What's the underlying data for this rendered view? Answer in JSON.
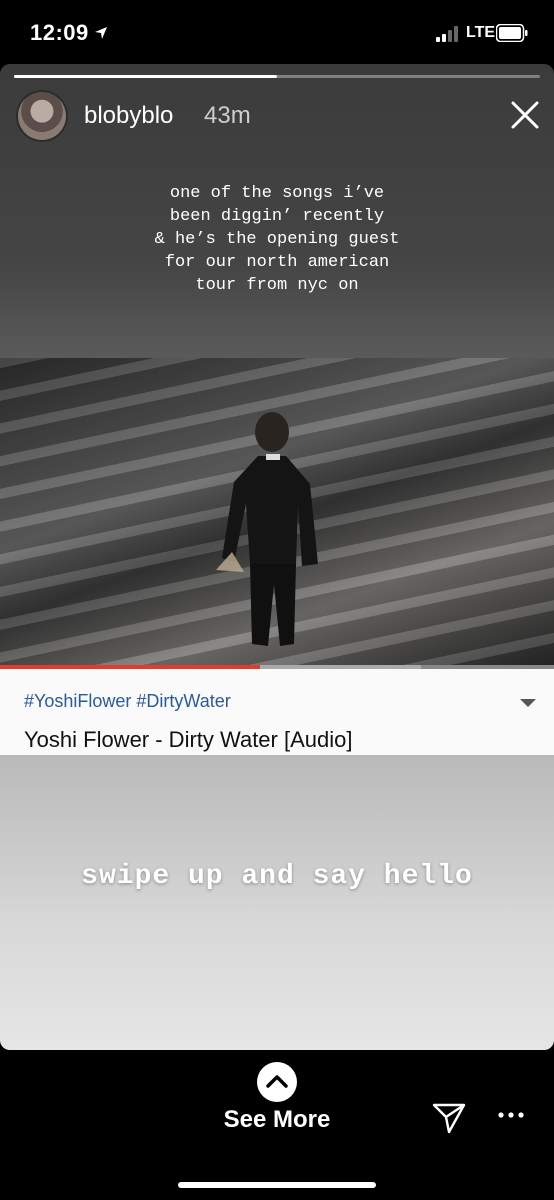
{
  "status_bar": {
    "time": "12:09",
    "network": "LTE",
    "icons": [
      "location-arrow-icon",
      "signal-icon",
      "battery-icon"
    ]
  },
  "story": {
    "username": "blobyblo",
    "time_ago": "43m",
    "progress": 0.5,
    "caption": "one of the songs i’ve\nbeen diggin’ recently\n& he’s the opening guest\nfor our north american\ntour from nyc on",
    "bottom_text": "swipe up and say hello",
    "close_icon": "close-icon"
  },
  "video": {
    "played_fraction": 0.47,
    "buffered_until": 0.76,
    "accent_color": "#e03c31"
  },
  "link_card": {
    "hashtags": "#YoshiFlower #DirtyWater",
    "title": "Yoshi Flower - Dirty Water [Audio]"
  },
  "footer": {
    "see_more_label": "See More",
    "icons": [
      "chevron-up-icon",
      "send-icon",
      "more-icon"
    ]
  }
}
